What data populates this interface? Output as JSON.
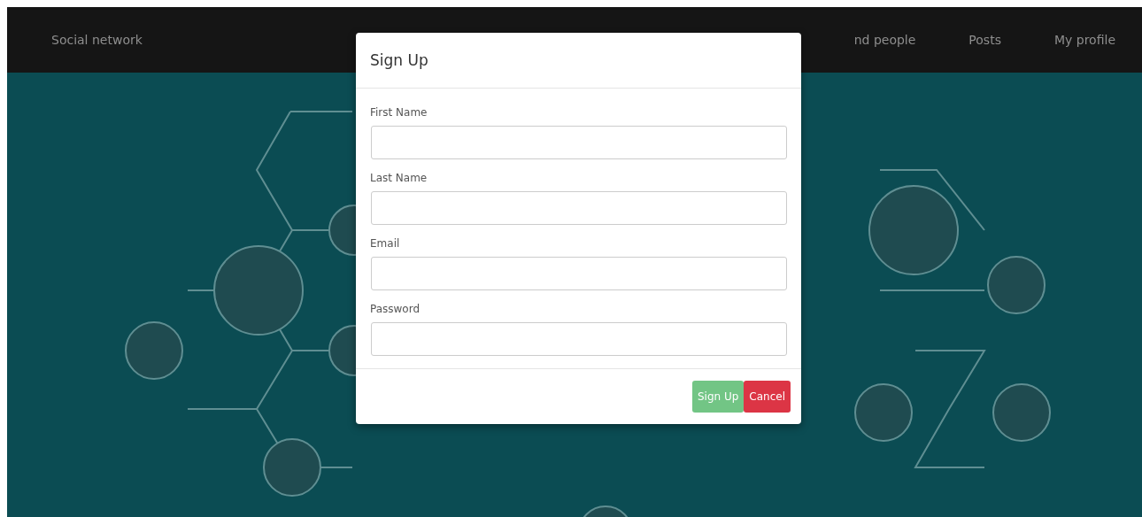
{
  "navbar": {
    "brand": "Social network",
    "links": [
      {
        "label": "nd people"
      },
      {
        "label": "Posts"
      },
      {
        "label": "My profile"
      }
    ]
  },
  "modal": {
    "title": "Sign Up",
    "fields": [
      {
        "label": "First Name"
      },
      {
        "label": "Last Name"
      },
      {
        "label": "Email"
      },
      {
        "label": "Password"
      }
    ],
    "buttons": [
      {
        "label": "Sign Up",
        "kind": "primary",
        "disabled": true
      },
      {
        "label": "Cancel",
        "kind": "danger",
        "disabled": false
      }
    ]
  }
}
